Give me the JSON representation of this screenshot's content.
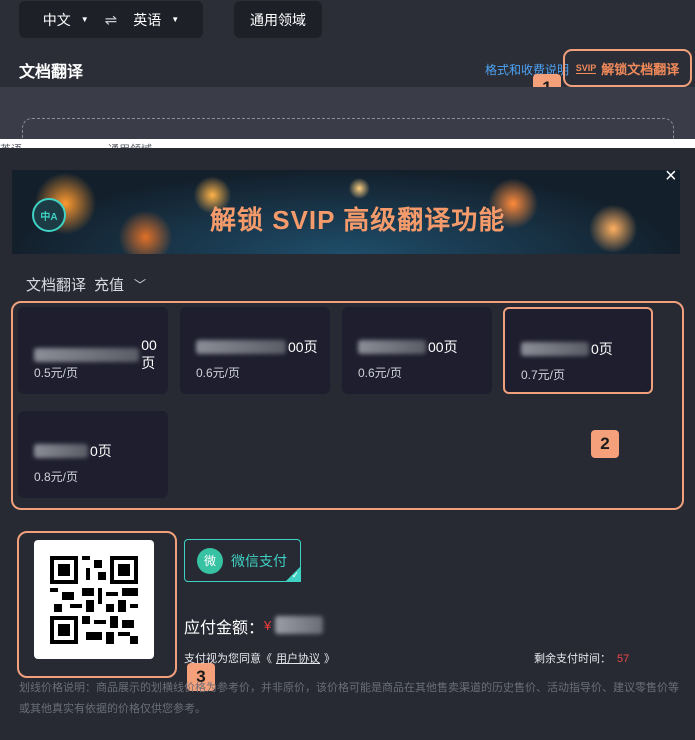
{
  "top_bar": {
    "source_lang": "中文",
    "target_lang": "英语",
    "domain_button": "通用领域"
  },
  "doc_section": {
    "title": "文档翻译",
    "fee_link": "格式和收费说明",
    "unlock_button": "解锁文档翻译",
    "svip_mark": "SVIP"
  },
  "annotation_badges": [
    "1",
    "2",
    "3"
  ],
  "background_ghost": {
    "left": "英语",
    "right": "通用领域"
  },
  "modal": {
    "banner_logo": "中A",
    "banner_title": "解锁 SVIP 高级翻译功能",
    "close_symbol": "×",
    "tab_left": "文档翻译",
    "tab_right": "充值",
    "packages": [
      {
        "amount_suffix": "00页",
        "price": "0.5元/页"
      },
      {
        "amount_suffix": "00页",
        "price": "0.6元/页"
      },
      {
        "amount_suffix": "00页",
        "price": "0.6元/页"
      },
      {
        "amount_suffix": "0页",
        "price": "0.7元/页"
      },
      {
        "amount_suffix": "0页",
        "price": "0.8元/页"
      }
    ],
    "payment_method": "微信支付",
    "payment_icon_glyph": "微",
    "pay_label": "应付金额：",
    "currency": "¥",
    "agree_prefix": "支付视为您同意《",
    "agree_link": "用户协议",
    "agree_suffix": "》",
    "timer_label": "剩余支付时间：",
    "timer_value": "57",
    "note": "划线价格说明：商品展示的划横线价格为参考价，并非原价，该价格可能是商品在其他售卖渠道的历史售价、活动指导价、建议零售价等或其他真实有依据的价格仅供您参考。"
  },
  "colors": {
    "accent": "#f0a07c",
    "wechat": "#3fd1c3",
    "link": "#4ea3f5",
    "timer": "#f04646"
  }
}
